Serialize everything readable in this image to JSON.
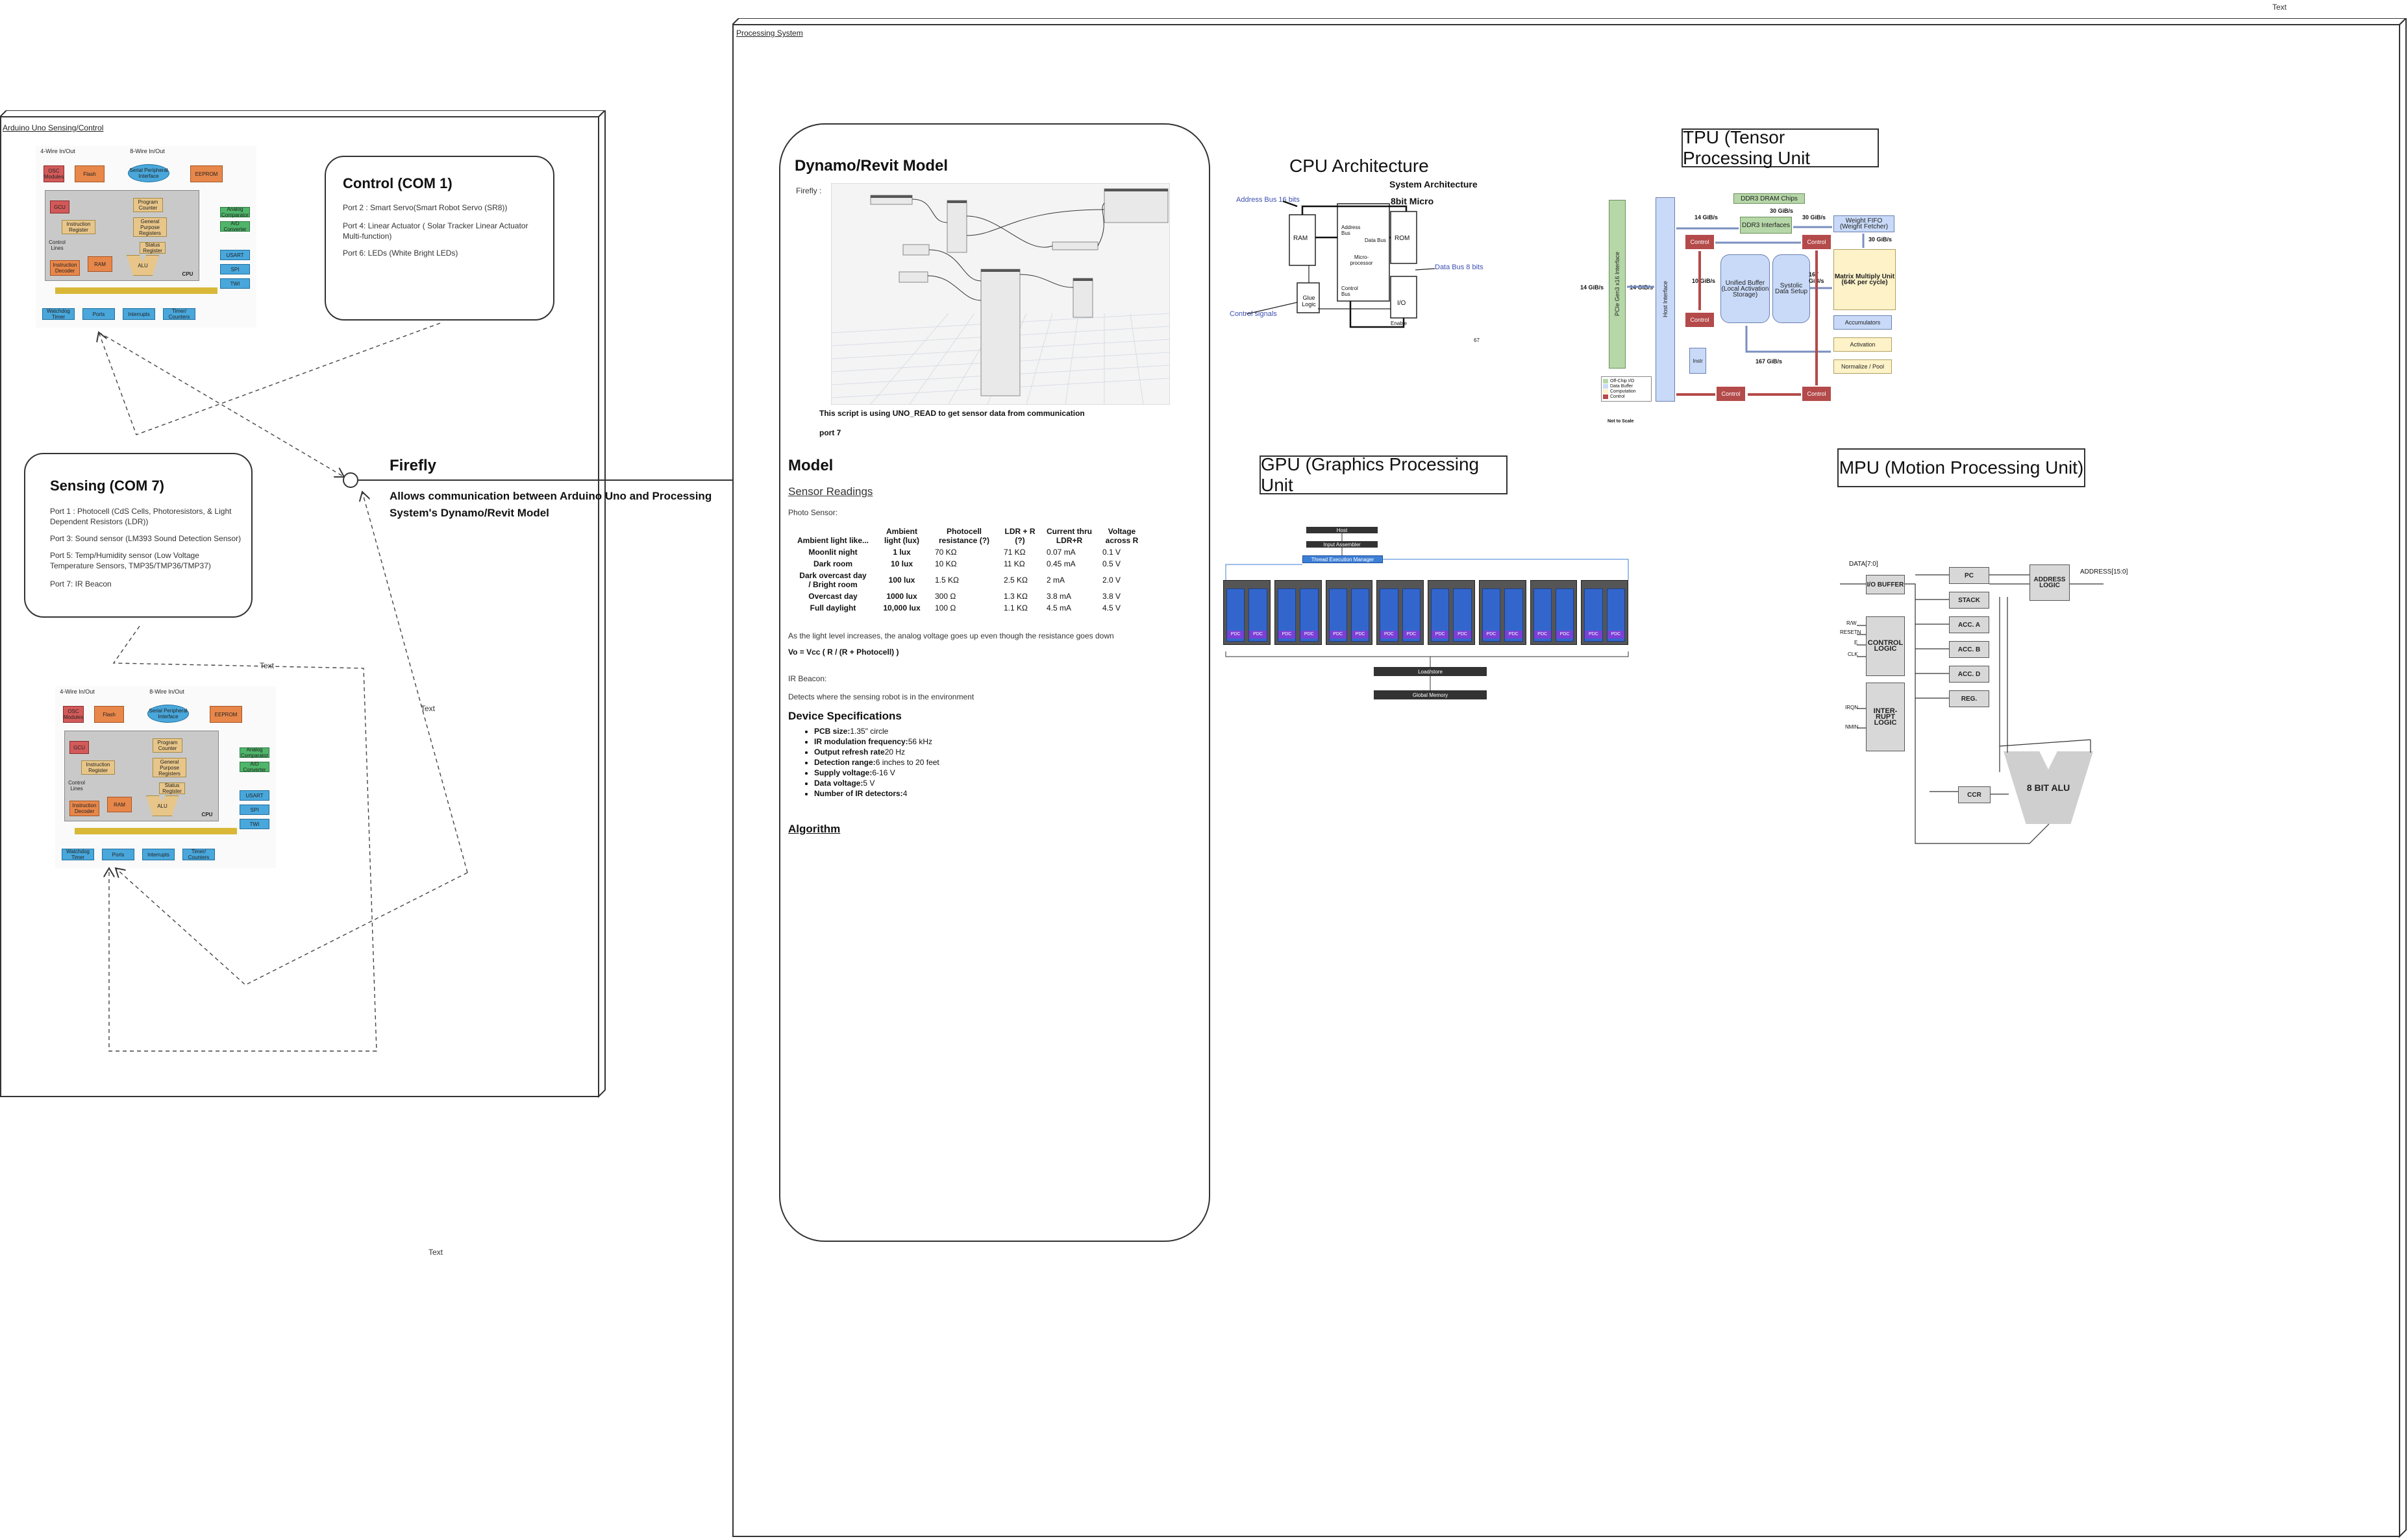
{
  "page": {
    "corner_text": "Text",
    "float_text_1": "Text",
    "float_text_2": "Text",
    "bottom_text": "Text"
  },
  "colors": {
    "accent_blue": "#3d7fd6",
    "arduino_orange": "#e8874a",
    "arduino_yellow": "#d9b838",
    "arduino_blue": "#49a7db",
    "arduino_green": "#4fb56a",
    "tpu_red": "#b44a4a",
    "tpu_green": "#b6d7a8",
    "tpu_blue": "#c9daf8",
    "gpu_blue": "#3366cc"
  },
  "arduino_panel": {
    "title": "Arduino Uno Sensing/Control"
  },
  "processing_panel": {
    "title": "Processing System"
  },
  "mcu": {
    "top_left": "4-Wire In/Out",
    "top_mid": "8-Wire In/Out",
    "blocks": {
      "osc": "OSC Modules",
      "flash": "Flash",
      "spi_iface": "Serial Peripheral Interface",
      "eeprom": "EEPROM",
      "gcu": "GCU",
      "program_counter": "Program Counter",
      "analog": "Analog Comparator",
      "instruction_register": "Instruction Register",
      "gp_registers": "General Purpose Registers",
      "adc": "A/D Converter",
      "control_lines": "Control Lines",
      "status": "Status Register",
      "instruction_decoder": "Instruction Decoder",
      "ram": "RAM",
      "alu": "ALU",
      "cpu": "CPU",
      "usart": "USART",
      "spi": "SPI",
      "twi": "TWI",
      "watchdog": "Watchdog Timer",
      "ports": "Ports",
      "interrupts": "Interrupts",
      "timers": "Timer/ Counters"
    }
  },
  "control": {
    "title": "Control (COM 1)",
    "lines": [
      "Port 2 : Smart Servo(Smart Robot Servo (SR8))",
      "Port 4: Linear Actuator ( Solar Tracker Linear Actuator Multi-function)",
      "Port 6: LEDs (White Bright LEDs)"
    ]
  },
  "sensing": {
    "title": "Sensing (COM 7)",
    "lines": [
      "Port 1 : Photocell (CdS Cells, Photoresistors, & Light Dependent Resistors (LDR))",
      "Port 3: Sound sensor (LM393 Sound Detection Sensor)",
      "Port 5: Temp/Humidity sensor (Low Voltage Temperature Sensors, TMP35/TMP36/TMP37)",
      "Port 7: IR Beacon"
    ]
  },
  "firefly": {
    "title": "Firefly",
    "description": "Allows communication between Arduino Uno and Processing System's Dynamo/Revit Model"
  },
  "dynamo": {
    "title": "Dynamo/Revit Model",
    "firefly_label": "Firefly :",
    "script_note_1": "This script is using UNO_READ to get sensor data from communication",
    "script_note_2": "port 7"
  },
  "model": {
    "title": "Model",
    "sensor_readings": "Sensor Readings",
    "photo_sensor": "Photo Sensor:",
    "table_headers": [
      "Ambient light like...",
      "Ambient light (lux)",
      "Photocell resistance (?)",
      "LDR + R (?)",
      "Current thru LDR+R",
      "Voltage across R"
    ],
    "table_rows": [
      [
        "Moonlit night",
        "1 lux",
        "70 KΩ",
        "71 KΩ",
        "0.07 mA",
        "0.1 V"
      ],
      [
        "Dark room",
        "10 lux",
        "10 KΩ",
        "11 KΩ",
        "0.45 mA",
        "0.5 V"
      ],
      [
        "Dark overcast day / Bright room",
        "100 lux",
        "1.5 KΩ",
        "2.5 KΩ",
        "2 mA",
        "2.0 V"
      ],
      [
        "Overcast day",
        "1000 lux",
        "300 Ω",
        "1.3 KΩ",
        "3.8 mA",
        "3.8 V"
      ],
      [
        "Full daylight",
        "10,000 lux",
        "100 Ω",
        "1.1 KΩ",
        "4.5 mA",
        "4.5 V"
      ]
    ],
    "note": "As the light level increases, the analog voltage goes up even though the resistance goes down",
    "formula": "Vo = Vcc ( R / (R + Photocell) )",
    "ir_label": "IR Beacon:",
    "ir_desc": "Detects where the sensing robot is in the environment",
    "device_specs_title": "Device Specifications",
    "specs": [
      {
        "k": "PCB size:",
        "v": "1.35\" circle"
      },
      {
        "k": "IR modulation frequency:",
        "v": "56 kHz"
      },
      {
        "k": "Output refresh rate",
        "v": "20 Hz"
      },
      {
        "k": "Detection range:",
        "v": "6 inches to 20 feet"
      },
      {
        "k": "Supply voltage:",
        "v": "6-16 V"
      },
      {
        "k": "Data voltage:",
        "v": "5 V"
      },
      {
        "k": "Number of IR detectors:",
        "v": "4"
      }
    ],
    "algorithm": "Algorithm"
  },
  "cpu": {
    "title": "CPU Architecture",
    "sys_arch": "System Architecture",
    "micro": "8bit Micro",
    "address_bus": "Address Bus 16 bits",
    "data_bus": "Data Bus 8 bits",
    "control_signals": "Control signals",
    "ram": "RAM",
    "rom": "ROM",
    "io": "I/O",
    "glue": "Glue Logic",
    "microprocessor": "Micro-processor",
    "address_bus_label": "Address Bus",
    "data_bus_label": "Data Bus",
    "control_bus": "Control Bus",
    "enable": "Enable",
    "page": "67"
  },
  "tpu": {
    "title": "TPU (Tensor Processing Unit",
    "ddr3_chips": "DDR3 DRAM Chips",
    "ddr3_if": "DDR3 Interfaces",
    "wfifo": "Weight FIFO (Weight Fetcher)",
    "control": "Control",
    "pcie": "PCIe Gen3 x16 Interface",
    "host_if": "Host Interface",
    "unified": "Unified Buffer (Local Activation Storage)",
    "systolic": "Systolic Data Setup",
    "mmu": "Matrix Multiply Unit (64K per cycle)",
    "accum": "Accumulators",
    "activation": "Activation",
    "norm": "Normalize / Pool",
    "bw_14a": "14 GiB/s",
    "bw_14b": "14 GiB/s",
    "bw_14c": "14 GiB/s",
    "bw_30a": "30 GiB/s",
    "bw_30b": "30 GiB/s",
    "bw_30c": "30 GiB/s",
    "bw_10": "10 GiB/s",
    "bw_167a": "167 GiB/s",
    "bw_167b": "167 GiB/s",
    "instr": "Instr",
    "legend": [
      "Off-Chip I/O",
      "Data Buffer",
      "Computation",
      "Control"
    ],
    "not_to_scale": "Not to Scale"
  },
  "gpu": {
    "title": "GPU (Graphics Processing Unit",
    "host": "Host",
    "input_assembler": "Input Assembler",
    "thread_manager": "Thread Execution Manager",
    "load_store": "Load/store",
    "global_memory": "Global Memory",
    "cluster": "Thread Processors",
    "pdc": "PDC"
  },
  "mpu": {
    "title": "MPU (Motion Processing Unit)",
    "data": "DATA[7:0]",
    "address": "ADDRESS[15:0]",
    "io_buffer": "I/O BUFFER",
    "control_logic": "CONTROL LOGIC",
    "interrupt_logic": "INTER- RUPT LOGIC",
    "pc": "PC",
    "stack": "STACK",
    "acc_a": "ACC. A",
    "acc_b": "ACC. B",
    "acc_d": "ACC. D",
    "reg": "REG.",
    "address_logic": "ADDRESS LOGIC",
    "ccr": "CCR",
    "alu": "8 BIT ALU",
    "sig_rw": "R/W",
    "sig_reset": "RESETN",
    "sig_e": "E",
    "sig_clk": "CLK",
    "sig_irq": "IRQN",
    "sig_nmi": "NMIN"
  }
}
